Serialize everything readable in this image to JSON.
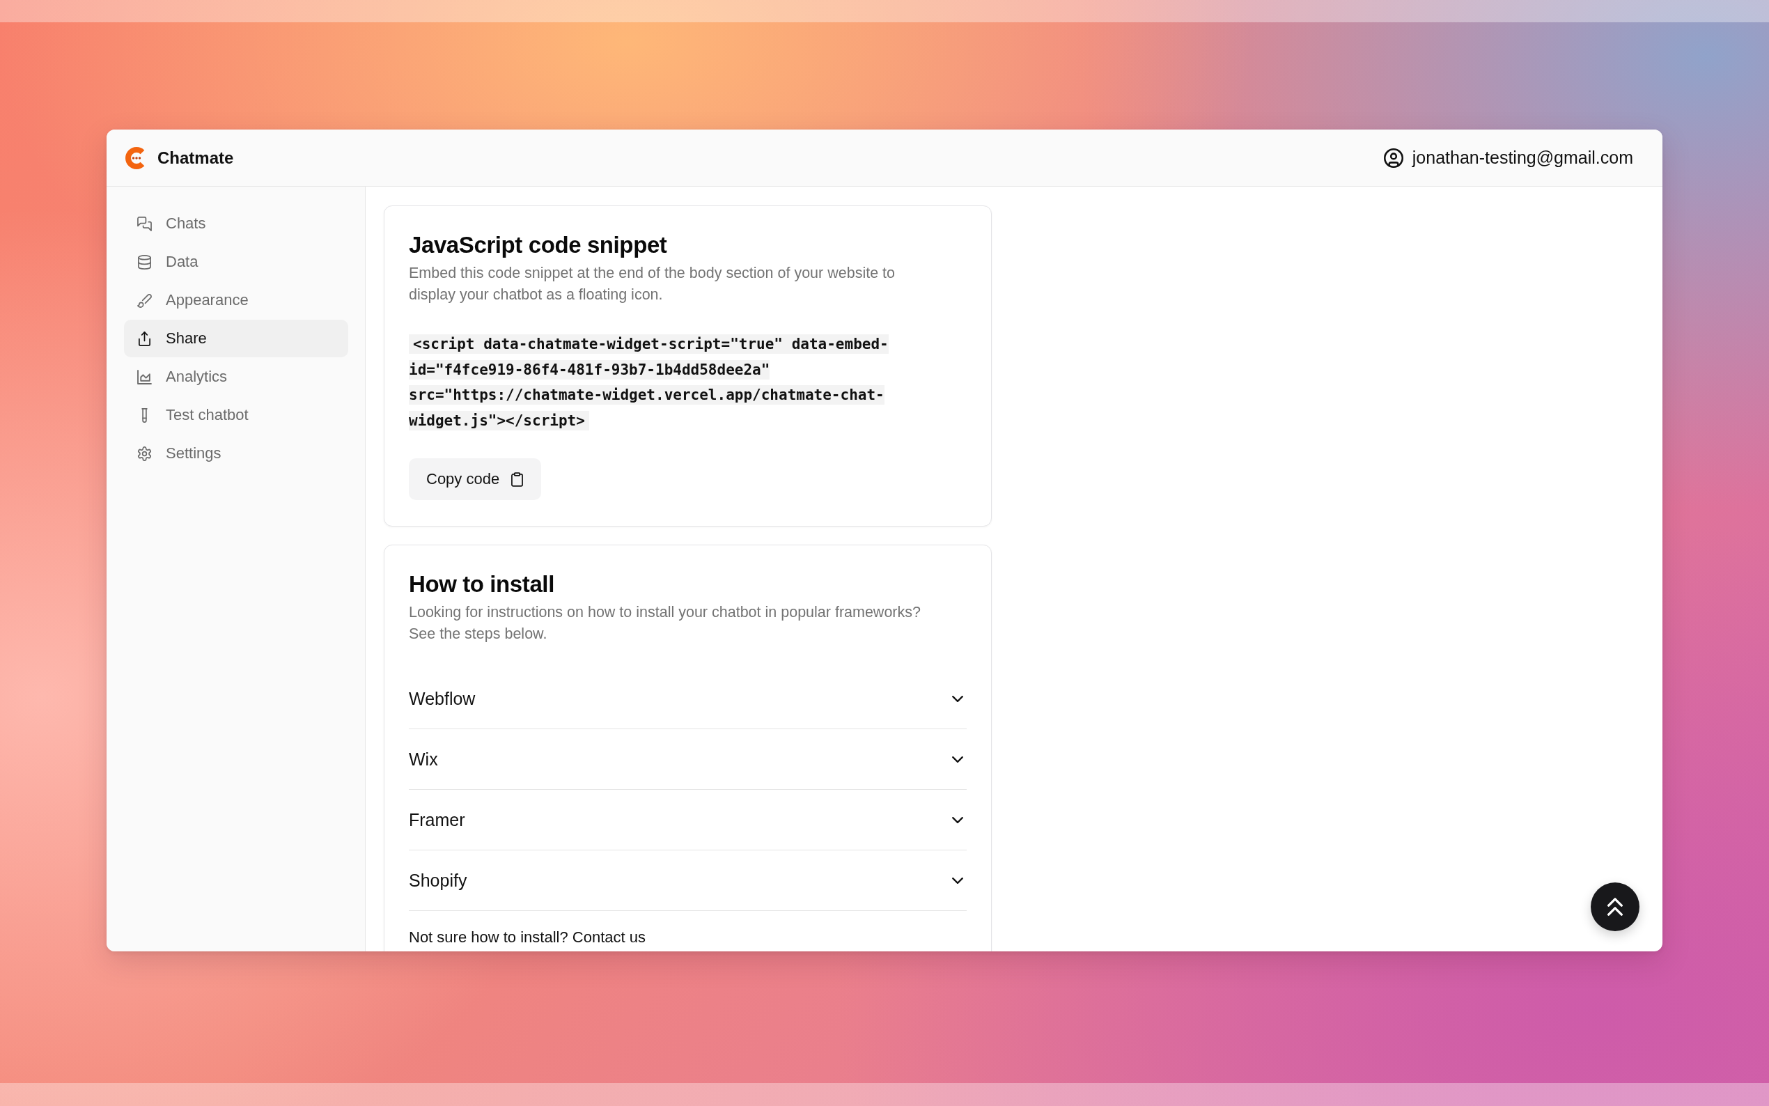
{
  "header": {
    "brand": "Chatmate",
    "account_email": "jonathan-testing@gmail.com"
  },
  "sidebar": {
    "items": [
      {
        "label": "Chats",
        "selected": false
      },
      {
        "label": "Data",
        "selected": false
      },
      {
        "label": "Appearance",
        "selected": false
      },
      {
        "label": "Share",
        "selected": true
      },
      {
        "label": "Analytics",
        "selected": false
      },
      {
        "label": "Test chatbot",
        "selected": false
      },
      {
        "label": "Settings",
        "selected": false
      }
    ]
  },
  "snippet_card": {
    "title": "JavaScript code snippet",
    "description": "Embed this code snippet at the end of the body section of your website to display your chatbot as a floating icon.",
    "code": "<script data-chatmate-widget-script=\"true\" data-embed-id=\"f4fce919-86f4-481f-93b7-1b4dd58dee2a\" src=\"https://chatmate-widget.vercel.app/chatmate-chat-widget.js\"></script>",
    "copy_button": "Copy code"
  },
  "install_card": {
    "title": "How to install",
    "description": "Looking for instructions on how to install your chatbot in popular frameworks? See the steps below.",
    "frameworks": [
      {
        "label": "Webflow",
        "expanded": false
      },
      {
        "label": "Wix",
        "expanded": false
      },
      {
        "label": "Framer",
        "expanded": false
      },
      {
        "label": "Shopify",
        "expanded": false
      }
    ],
    "help": {
      "text": "Not sure how to install?",
      "link": "Contact us"
    }
  }
}
